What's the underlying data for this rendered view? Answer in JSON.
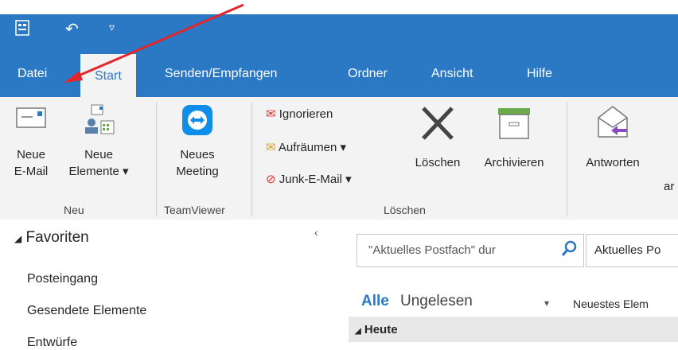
{
  "tabs": [
    "Datei",
    "Start",
    "Senden/Empfangen",
    "Ordner",
    "Ansicht",
    "Hilfe"
  ],
  "ribbon": {
    "new_email": [
      "Neue",
      "E-Mail"
    ],
    "new_items": [
      "Neue",
      "Elemente ▾"
    ],
    "new_meeting": [
      "Neues",
      "Meeting"
    ],
    "ignore": "Ignorieren",
    "cleanup": "Aufräumen ▾",
    "junk": "Junk-E-Mail ▾",
    "delete": "Löschen",
    "archive": "Archivieren",
    "reply": "Antworten",
    "reply_all_partial": "ar",
    "group_new": "Neu",
    "group_teamviewer": "TeamViewer",
    "group_delete": "Löschen"
  },
  "nav": {
    "favorites": "Favoriten",
    "items": [
      "Posteingang",
      "Gesendete Elemente",
      "Entwürfe"
    ]
  },
  "main": {
    "search_placeholder": "\"Aktuelles Postfach\" dur",
    "scope_label": "Aktuelles Po",
    "filter_all": "Alle",
    "filter_unread": "Ungelesen",
    "sort_label": "Neuestes Elem",
    "group_today": "Heute"
  },
  "colors": {
    "accent": "#2b78c5",
    "annotation_arrow": "#e3262b"
  }
}
